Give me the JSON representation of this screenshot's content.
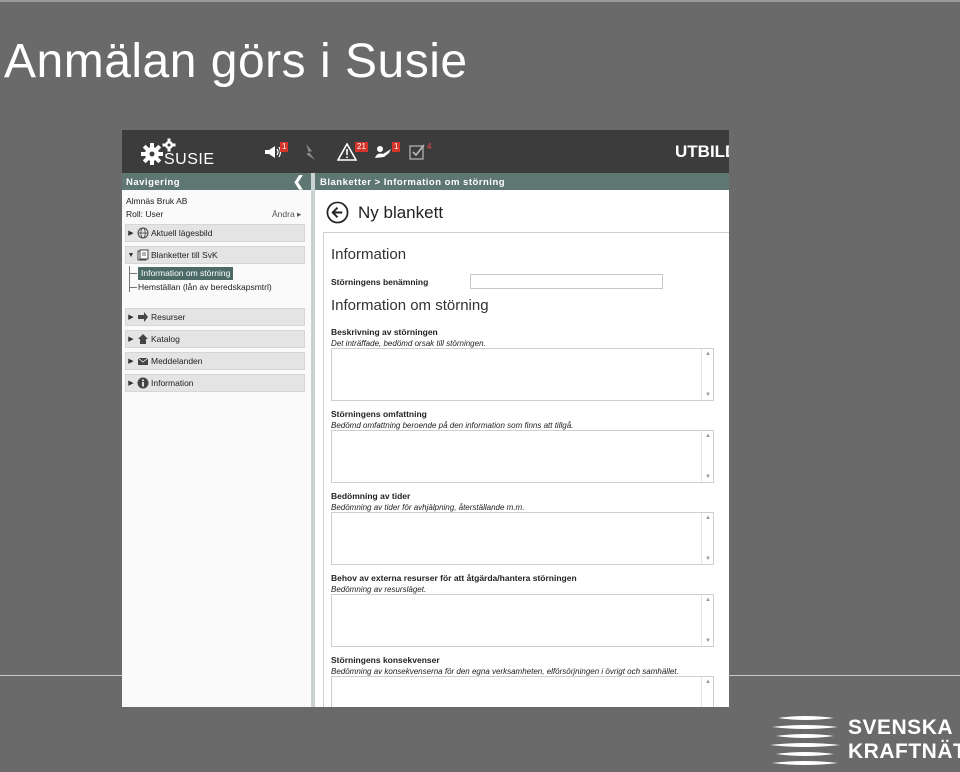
{
  "slide": {
    "title": "Anmälan görs i Susie"
  },
  "app": {
    "logo_text": "SUSIE",
    "environment": "UTBILD",
    "toolbar": {
      "announcement_count": "1",
      "warning_count": "21",
      "operation_count": "1",
      "task_count": "4"
    }
  },
  "navigation": {
    "header": "Navigering",
    "organization": "Almnäs Bruk AB",
    "role": "Roll: User",
    "change_label": "Ändra ▸",
    "items": [
      {
        "label": "Aktuell lägesbild",
        "icon": "globe-icon"
      },
      {
        "label": "Blanketter till SvK",
        "icon": "forms-icon"
      },
      {
        "label": "Resurser",
        "icon": "arrow-icon"
      },
      {
        "label": "Katalog",
        "icon": "house-icon"
      },
      {
        "label": "Meddelanden",
        "icon": "mail-icon"
      },
      {
        "label": "Information",
        "icon": "info-icon"
      }
    ],
    "subitems": [
      {
        "label": "Information om störning"
      },
      {
        "label": "Hemställan (lån av beredskapsmtrl)"
      }
    ]
  },
  "breadcrumb": "Blanketter > Information om störning",
  "form": {
    "title": "Ny blankett",
    "section1": "Information",
    "name_label": "Störningens benämning",
    "name_value": "",
    "section2": "Information om störning",
    "fields": [
      {
        "label": "Beskrivning av störningen",
        "hint": "Det inträffade, bedömd orsak till störningen."
      },
      {
        "label": "Störningens omfattning",
        "hint": "Bedömd omfattning beroende på den information som finns att tillgå."
      },
      {
        "label": "Bedömning av tider",
        "hint": "Bedömning av tider för avhjälpning, återställande m.m."
      },
      {
        "label": "Behov av externa resurser för att åtgärda/hantera störningen",
        "hint": "Bedömning av resursläget."
      },
      {
        "label": "Störningens konsekvenser",
        "hint": "Bedömning av konsekvenserna för den egna verksamheten, elförsörjningen i övrigt och samhället."
      }
    ]
  },
  "brand": {
    "line1": "SVENSKA",
    "line2": "KRAFTNÄT"
  }
}
